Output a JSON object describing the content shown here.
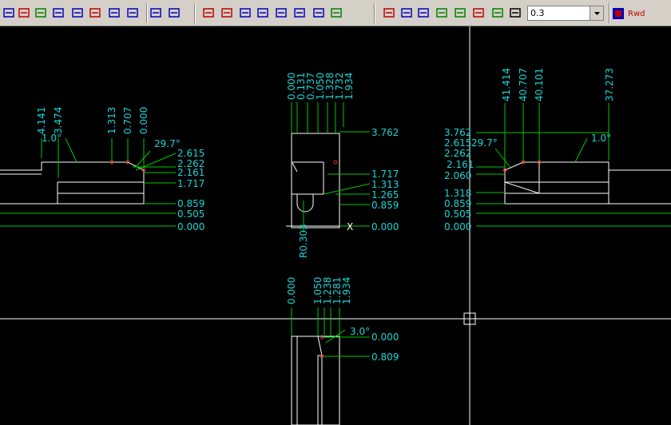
{
  "toolbar": {
    "icons": [
      "dim-vertical-icon",
      "dim-angled-icon",
      "dim-point-icon",
      "dim-stack-icon",
      "dim-horizontal-icon",
      "dim-aligned-icon",
      "dim-ne-icon",
      "dim-ne2-icon",
      "zoom-window-icon",
      "zoom-extents-icon",
      "edit-dim-icon",
      "dim-red-1-icon",
      "dim-blue-1-icon",
      "dim-blue-2-icon",
      "dim-blue-3-icon",
      "dim-blue-4-icon",
      "dim-blue-5-icon",
      "dim-green-icon",
      "snap-red-icon",
      "snap-grid-icon",
      "snap-mid-icon",
      "curve-icon",
      "lines-icon",
      "color-dim-icon",
      "check-icon",
      "angle-icon"
    ],
    "combo_value": "0.3",
    "rwd_label": "Rwd"
  },
  "drawing": {
    "left_view": {
      "top_dims": [
        "4.141",
        "3.474",
        "1.313",
        "0.707",
        "0.000"
      ],
      "angle": "1.0°",
      "angle2": "29.7°",
      "right_dims": [
        "2.615",
        "2.262",
        "2.161",
        "1.717",
        "0.859",
        "0.505",
        "0.000"
      ]
    },
    "center_view": {
      "top_dims": [
        "0.000",
        "0.131",
        "0.737",
        "1.050",
        "1.328",
        "1.732",
        "1.934"
      ],
      "right_dims": [
        "3.762",
        "1.717",
        "1.313",
        "1.265",
        "0.859",
        "0.000"
      ],
      "radius": "R0.303",
      "axis_label": "X"
    },
    "right_view": {
      "top_dims": [
        "41.414",
        "40.707",
        "40.101",
        "37.273"
      ],
      "angle": "1.0°",
      "angle2": "29.7°",
      "left_dims": [
        "3.762",
        "2.615",
        "2.262",
        "2.161",
        "2.060",
        "1.318",
        "0.859",
        "0.505",
        "0.000"
      ]
    },
    "bottom_view": {
      "top_dims": [
        "0.000",
        "1.050",
        "1.238",
        "1.281",
        "1.934"
      ],
      "angle": "3.0°",
      "right_dims": [
        "0.000",
        "0.809"
      ]
    }
  }
}
